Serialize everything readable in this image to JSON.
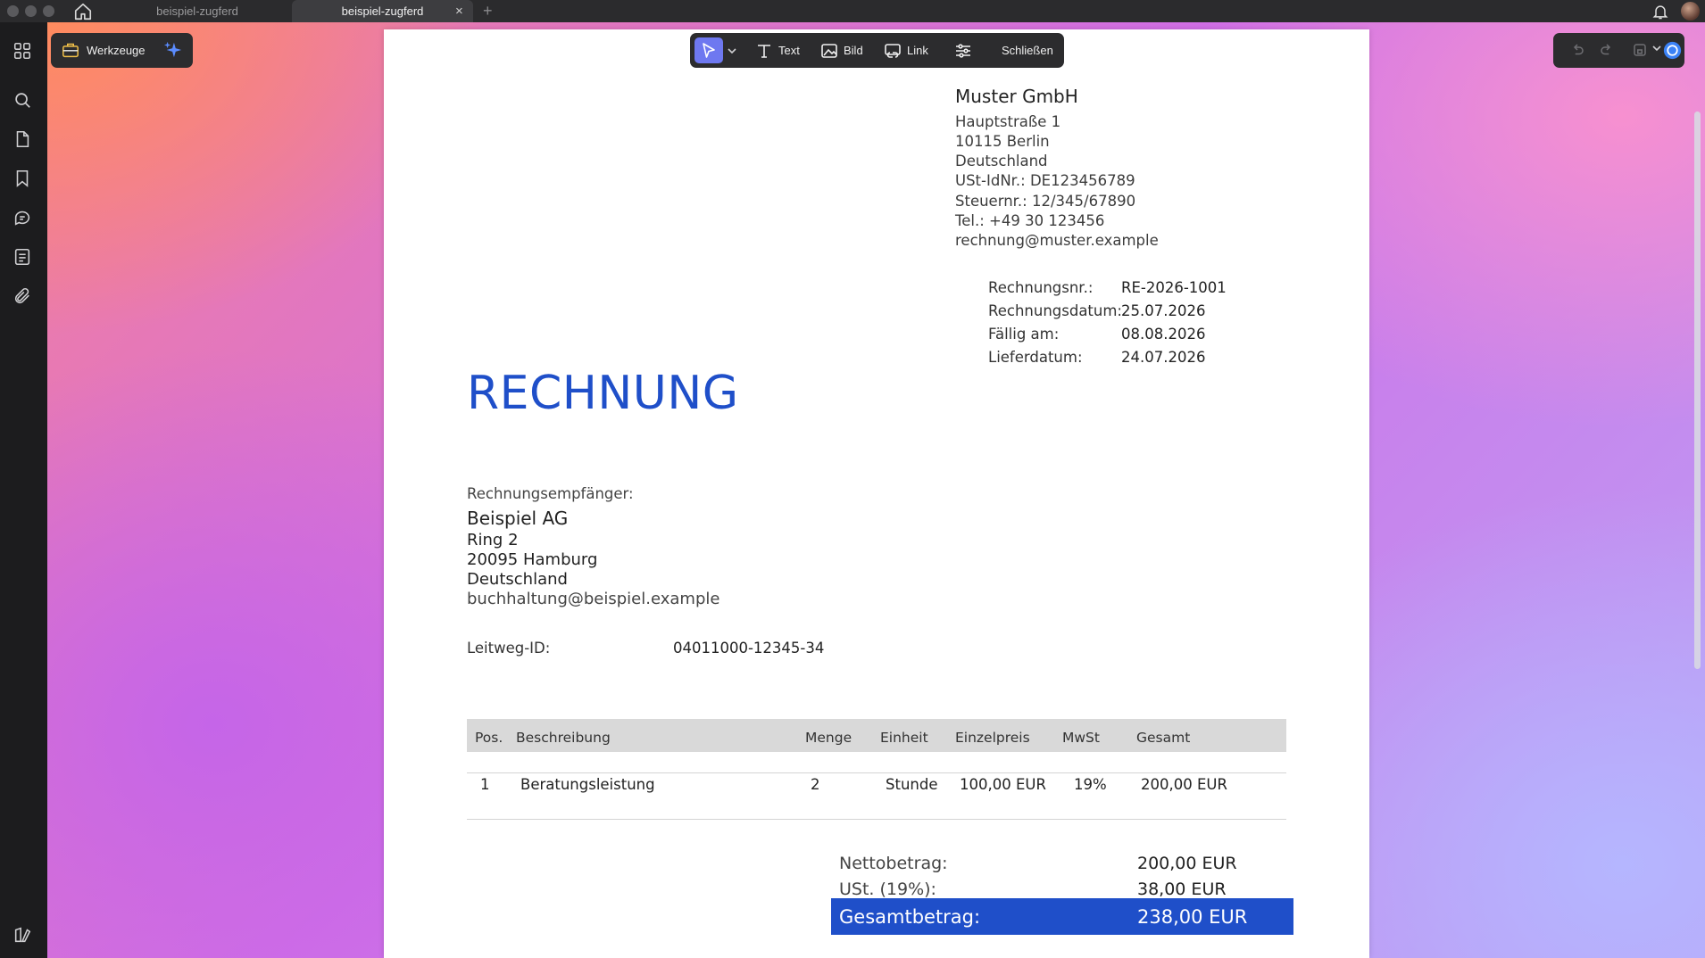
{
  "titlebar": {
    "tabs": [
      {
        "label": "beispiel-zugferd",
        "active": false
      },
      {
        "label": "beispiel-zugferd",
        "active": true
      }
    ],
    "close_glyph": "×",
    "add_glyph": "+"
  },
  "toolbar_left": {
    "tools_label": "Werkzeuge"
  },
  "edit_toolbar": {
    "text_label": "Text",
    "image_label": "Bild",
    "link_label": "Link",
    "close_label": "Schließen"
  },
  "invoice": {
    "seller": {
      "name": "Muster GmbH",
      "lines": [
        "Hauptstraße 1",
        "10115 Berlin",
        "Deutschland",
        "USt-IdNr.: DE123456789",
        "Steuernr.: 12/345/67890",
        "Tel.: +49 30 123456",
        "rechnung@muster.example"
      ]
    },
    "meta": [
      {
        "label": "Rechnungsnr.:",
        "value": "RE-2026-1001"
      },
      {
        "label": "Rechnungsdatum:",
        "value": "25.07.2026"
      },
      {
        "label": "Fällig am:",
        "value": "08.08.2026"
      },
      {
        "label": "Lieferdatum:",
        "value": "24.07.2026"
      }
    ],
    "title": "RECHNUNG",
    "recipient": {
      "label": "Rechnungsempfänger:",
      "name": "Beispiel AG",
      "lines": [
        "Ring 2",
        "20095 Hamburg",
        "Deutschland"
      ],
      "email": "buchhaltung@beispiel.example"
    },
    "leitweg": {
      "label": "Leitweg-ID:",
      "value": "04011000-12345-34"
    },
    "table": {
      "headers": [
        "Pos.",
        "Beschreibung",
        "Menge",
        "Einheit",
        "Einzelpreis",
        "MwSt",
        "Gesamt"
      ],
      "rows": [
        [
          "1",
          "Beratungsleistung",
          "2",
          "Stunde",
          "100,00 EUR",
          "19%",
          "200,00 EUR"
        ]
      ]
    },
    "totals": {
      "net_label": "Nettobetrag:",
      "net_value": "200,00 EUR",
      "vat_label": "USt. (19%):",
      "vat_value": "38,00 EUR",
      "gross_label": "Gesamtbetrag:",
      "gross_value": "238,00 EUR"
    }
  }
}
